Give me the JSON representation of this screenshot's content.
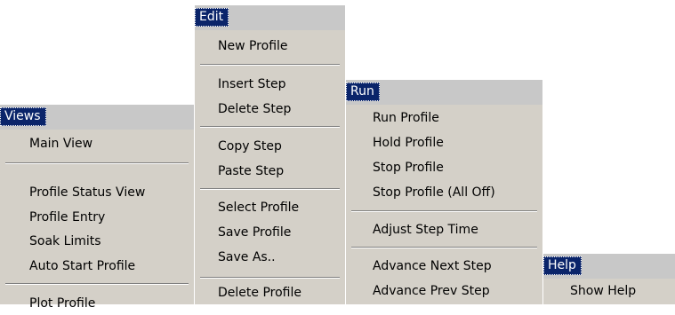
{
  "views": {
    "title": "Views",
    "items": [
      "Main View",
      "Profile Status View",
      "Profile Entry",
      "Soak Limits",
      "Auto Start Profile",
      "Plot Profile"
    ]
  },
  "edit": {
    "title": "Edit",
    "items": [
      "New Profile",
      "Insert Step",
      "Delete Step",
      "Copy Step",
      "Paste Step",
      "Select Profile",
      "Save Profile",
      "Save As..",
      "Delete Profile"
    ]
  },
  "run": {
    "title": "Run",
    "items": [
      "Run Profile",
      "Hold Profile",
      "Stop Profile",
      "Stop Profile (All Off)",
      "Adjust Step Time",
      "Advance Next Step",
      "Advance Prev Step"
    ]
  },
  "help": {
    "title": "Help",
    "items": [
      "Show Help"
    ]
  }
}
